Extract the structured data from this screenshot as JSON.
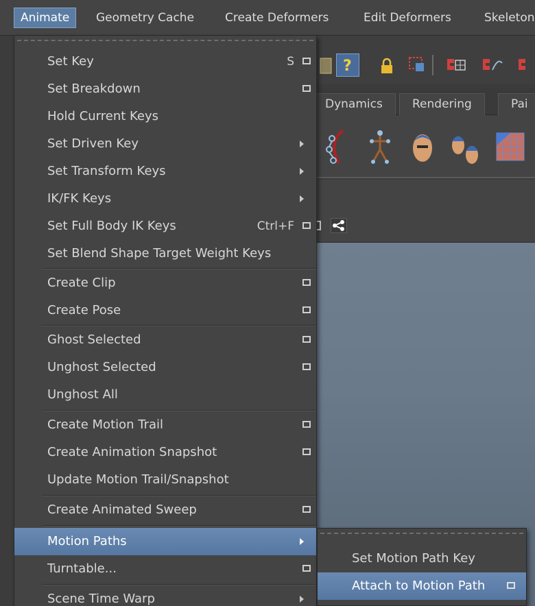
{
  "menubar": {
    "items": [
      "Animate",
      "Geometry Cache",
      "Create Deformers",
      "Edit Deformers",
      "Skeleton"
    ]
  },
  "shelf": {
    "tabs": [
      "Dynamics",
      "Rendering",
      "Pai"
    ]
  },
  "icons": {
    "toolbar": [
      "question-icon",
      "lock-icon",
      "selection-mask-icon",
      "magnet-grid-icon",
      "magnet-curve-icon"
    ],
    "shelf": [
      "joint-chain-icon",
      "skeleton-icon",
      "head-icon",
      "heads-icon",
      "texture-icon"
    ],
    "panel": [
      "option-box-icon",
      "share-icon"
    ]
  },
  "animate_menu": {
    "items": [
      {
        "label": "Set Key",
        "shortcut": "S",
        "option_box": true,
        "submenu": false
      },
      {
        "label": "Set Breakdown",
        "shortcut": "",
        "option_box": true,
        "submenu": false
      },
      {
        "label": "Hold Current Keys",
        "shortcut": "",
        "option_box": false,
        "submenu": false
      },
      {
        "label": "Set Driven Key",
        "shortcut": "",
        "option_box": false,
        "submenu": true
      },
      {
        "label": "Set Transform Keys",
        "shortcut": "",
        "option_box": false,
        "submenu": true
      },
      {
        "label": "IK/FK Keys",
        "shortcut": "",
        "option_box": false,
        "submenu": true
      },
      {
        "label": "Set Full Body IK Keys",
        "shortcut": "Ctrl+F",
        "option_box": true,
        "submenu": false
      },
      {
        "label": "Set Blend Shape Target Weight Keys",
        "shortcut": "",
        "option_box": false,
        "submenu": false
      },
      {
        "label": "Create Clip",
        "shortcut": "",
        "option_box": true,
        "submenu": false
      },
      {
        "label": "Create Pose",
        "shortcut": "",
        "option_box": true,
        "submenu": false
      },
      {
        "label": "Ghost Selected",
        "shortcut": "",
        "option_box": true,
        "submenu": false
      },
      {
        "label": "Unghost Selected",
        "shortcut": "",
        "option_box": true,
        "submenu": false
      },
      {
        "label": "Unghost All",
        "shortcut": "",
        "option_box": false,
        "submenu": false
      },
      {
        "label": "Create Motion Trail",
        "shortcut": "",
        "option_box": true,
        "submenu": false
      },
      {
        "label": "Create Animation Snapshot",
        "shortcut": "",
        "option_box": true,
        "submenu": false
      },
      {
        "label": "Update Motion Trail/Snapshot",
        "shortcut": "",
        "option_box": false,
        "submenu": false
      },
      {
        "label": "Create Animated Sweep",
        "shortcut": "",
        "option_box": true,
        "submenu": false
      },
      {
        "label": "Motion Paths",
        "shortcut": "",
        "option_box": false,
        "submenu": true,
        "highlighted": true
      },
      {
        "label": "Turntable...",
        "shortcut": "",
        "option_box": true,
        "submenu": false
      },
      {
        "label": "Scene Time Warp",
        "shortcut": "",
        "option_box": false,
        "submenu": true
      }
    ]
  },
  "motion_paths_submenu": {
    "items": [
      {
        "label": "Set Motion Path Key",
        "option_box": false
      },
      {
        "label": "Attach to Motion Path",
        "option_box": true,
        "highlighted": true
      }
    ]
  },
  "colors": {
    "menu_bg": "#444444",
    "highlight": "#5a7aa3",
    "text": "#d8d8d8",
    "viewport": "#6a7a8a"
  }
}
